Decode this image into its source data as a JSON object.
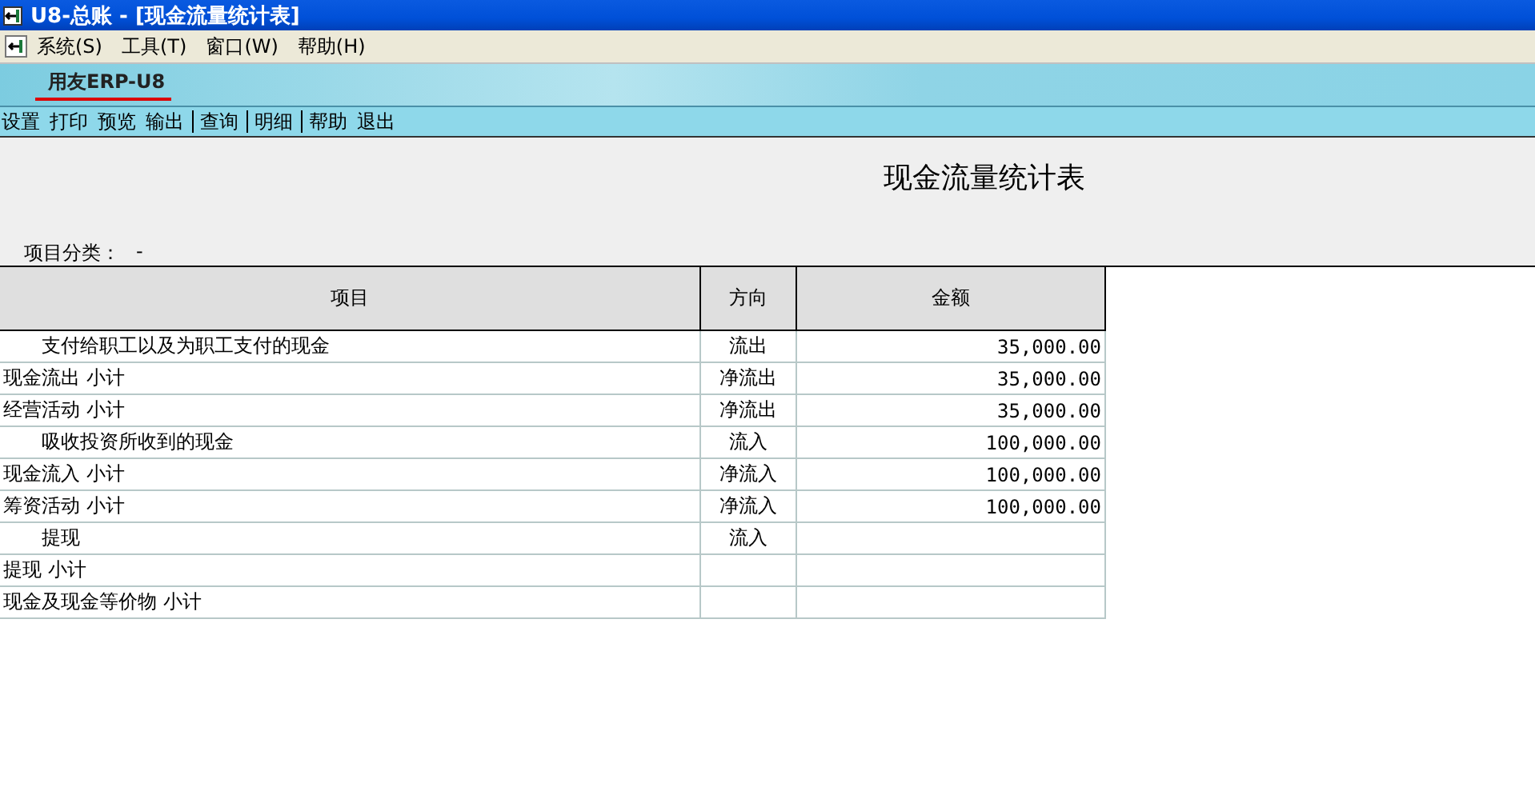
{
  "window": {
    "title": "U8-总账 - [现金流量统计表]"
  },
  "menu": [
    {
      "label": "系统(S)"
    },
    {
      "label": "工具(T)"
    },
    {
      "label": "窗口(W)"
    },
    {
      "label": "帮助(H)"
    }
  ],
  "logo": {
    "text": "用友ERP-U8"
  },
  "toolbar": [
    [
      "设置",
      "打印",
      "预览",
      "输出"
    ],
    [
      "查询"
    ],
    [
      "明细"
    ],
    [
      "帮助",
      "退出"
    ]
  ],
  "report": {
    "title": "现金流量统计表",
    "category_label": "项目分类：",
    "category_value": "-"
  },
  "table": {
    "columns": [
      "项目",
      "方向",
      "金额"
    ],
    "rows": [
      {
        "kind": "detail",
        "item": "支付给职工以及为职工支付的现金",
        "direction": "流出",
        "amount": "35,000.00"
      },
      {
        "kind": "subtotal",
        "item": "现金流出 小计",
        "direction": "净流出",
        "amount": "35,000.00"
      },
      {
        "kind": "subtotal",
        "item": "经营活动 小计",
        "direction": "净流出",
        "amount": "35,000.00"
      },
      {
        "kind": "detail",
        "item": "吸收投资所收到的现金",
        "direction": "流入",
        "amount": "100,000.00"
      },
      {
        "kind": "subtotal",
        "item": "现金流入 小计",
        "direction": "净流入",
        "amount": "100,000.00"
      },
      {
        "kind": "subtotal",
        "item": "筹资活动 小计",
        "direction": "净流入",
        "amount": "100,000.00"
      },
      {
        "kind": "detail",
        "item": "提现",
        "direction": "流入"
      },
      {
        "kind": "subtotal",
        "item": "提现 小计"
      },
      {
        "kind": "subtotal",
        "item": "现金及现金等价物 小计"
      }
    ]
  }
}
